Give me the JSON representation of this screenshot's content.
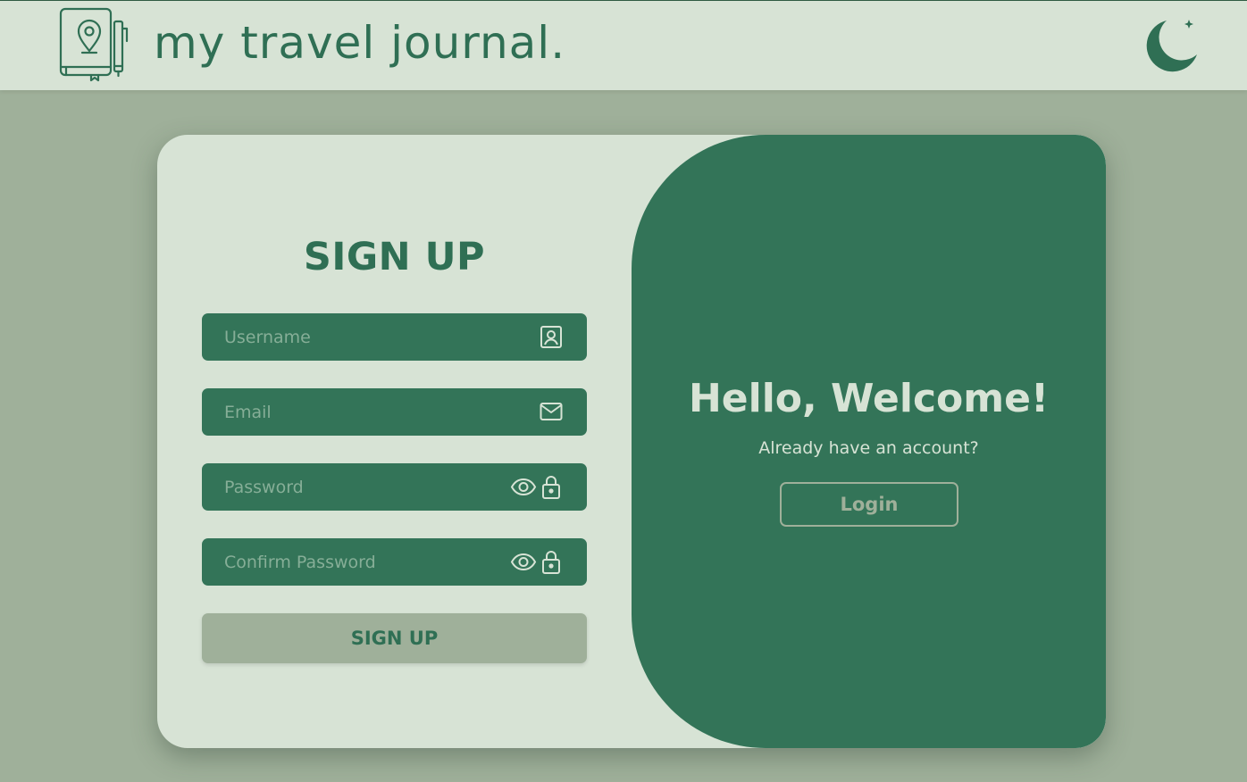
{
  "header": {
    "title": "my travel journal.",
    "logo_icon": "journal-map-pin-icon",
    "theme_toggle_icon": "moon-stars-icon"
  },
  "signup": {
    "title": "SIGN UP",
    "fields": {
      "username": {
        "placeholder": "Username",
        "value": "",
        "icon": "user-badge-icon"
      },
      "email": {
        "placeholder": "Email",
        "value": "",
        "icon": "mail-icon"
      },
      "password": {
        "placeholder": "Password",
        "value": "",
        "icons": [
          "eye-icon",
          "lock-icon"
        ]
      },
      "confirm_password": {
        "placeholder": "Confirm Password",
        "value": "",
        "icons": [
          "eye-icon",
          "lock-icon"
        ]
      }
    },
    "submit_label": "SIGN UP"
  },
  "welcome_panel": {
    "heading": "Hello, Welcome!",
    "subtext": "Already have an account?",
    "login_label": "Login"
  },
  "colors": {
    "background": "#9fb09a",
    "surface": "#d7e3d5",
    "primary": "#337458",
    "text_dark": "#2f6f54",
    "placeholder": "#86ae97"
  }
}
